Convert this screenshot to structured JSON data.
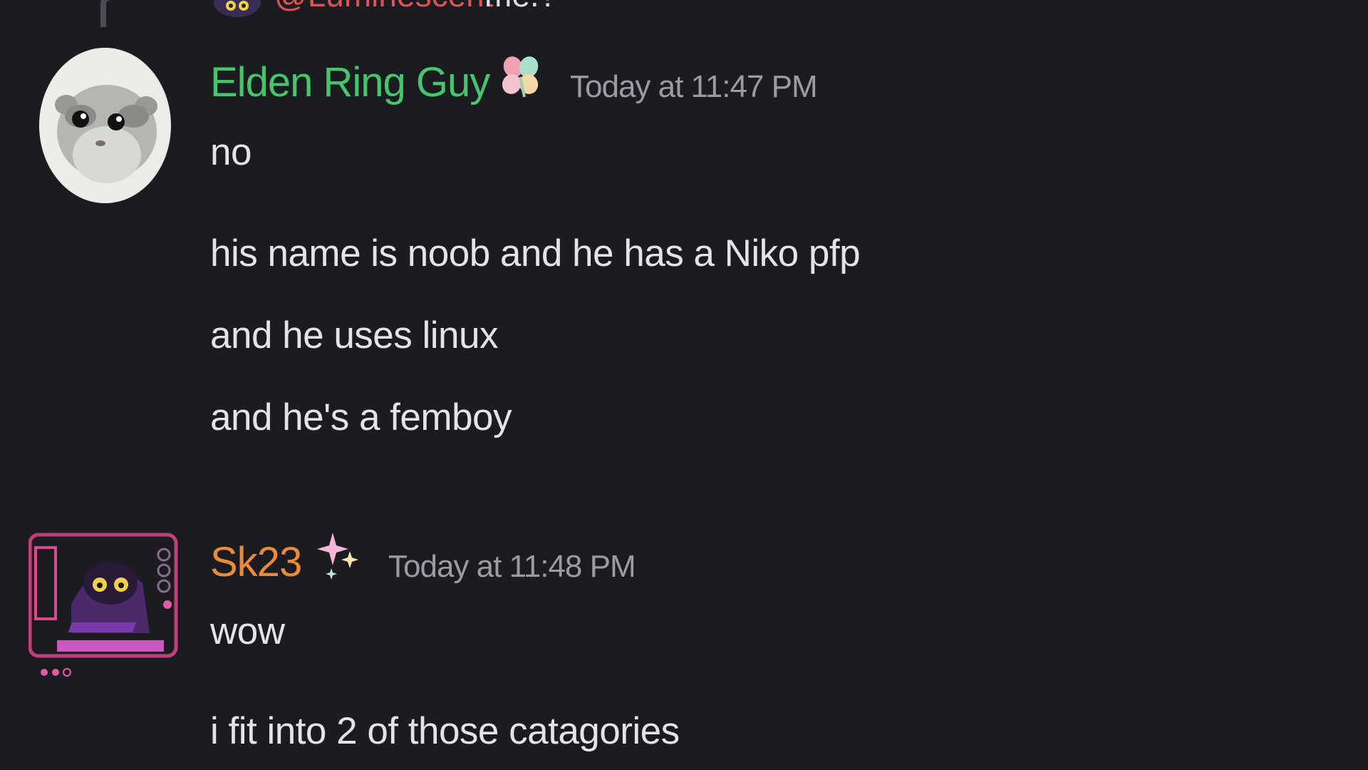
{
  "reply_preview": {
    "name": "@Luminescent",
    "text": "me.?"
  },
  "messages": [
    {
      "username": "Elden Ring Guy",
      "username_color": "#48c46c",
      "badge_icon": "clover-icon",
      "timestamp": "Today at 11:47 PM",
      "avatar_icon": "hamster-avatar",
      "lines": [
        "no",
        "his name is noob and he has a Niko pfp",
        "and he uses linux",
        "and he's a femboy"
      ]
    },
    {
      "username": "Sk23",
      "username_color": "#e98b3c",
      "badge_icon": "sparkles-icon",
      "timestamp": "Today at 11:48 PM",
      "avatar_icon": "niko-cat-avatar",
      "lines": [
        "wow",
        "i fit into 2 of those catagories"
      ]
    }
  ],
  "colors": {
    "background": "#1b1c21",
    "text": "#e3e4e8",
    "timestamp": "#9a9ba3",
    "mention": "#e05252"
  }
}
